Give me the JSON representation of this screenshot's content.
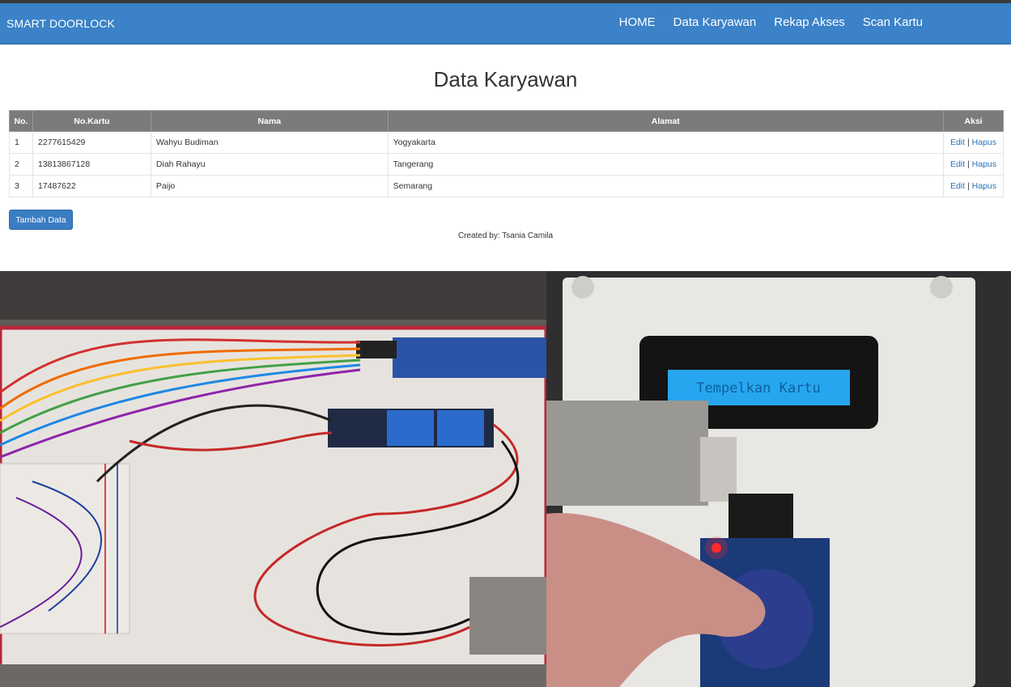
{
  "navbar": {
    "brand": "SMART DOORLOCK",
    "links": [
      "HOME",
      "Data Karyawan",
      "Rekap Akses",
      "Scan Kartu"
    ],
    "color": "#3b82c8"
  },
  "page": {
    "title": "Data Karyawan"
  },
  "table": {
    "headers": [
      "No.",
      "No.Kartu",
      "Nama",
      "Alamat",
      "Aksi"
    ],
    "rows": [
      {
        "no": "1",
        "kartu": "2277615429",
        "nama": "Wahyu Budiman",
        "alamat": "Yogyakarta"
      },
      {
        "no": "2",
        "kartu": "13813867128",
        "nama": "Diah Rahayu",
        "alamat": "Tangerang"
      },
      {
        "no": "3",
        "kartu": "17487622",
        "nama": "Paijo",
        "alamat": "Semarang"
      }
    ],
    "actions": {
      "edit": "Edit",
      "separator": "|",
      "delete": "Hapus"
    }
  },
  "buttons": {
    "add": "Tambah Data"
  },
  "footer": {
    "credit": "Created by: Tsania Camila"
  },
  "photos": {
    "right_lcd_text": "Tempelkan Kartu"
  }
}
